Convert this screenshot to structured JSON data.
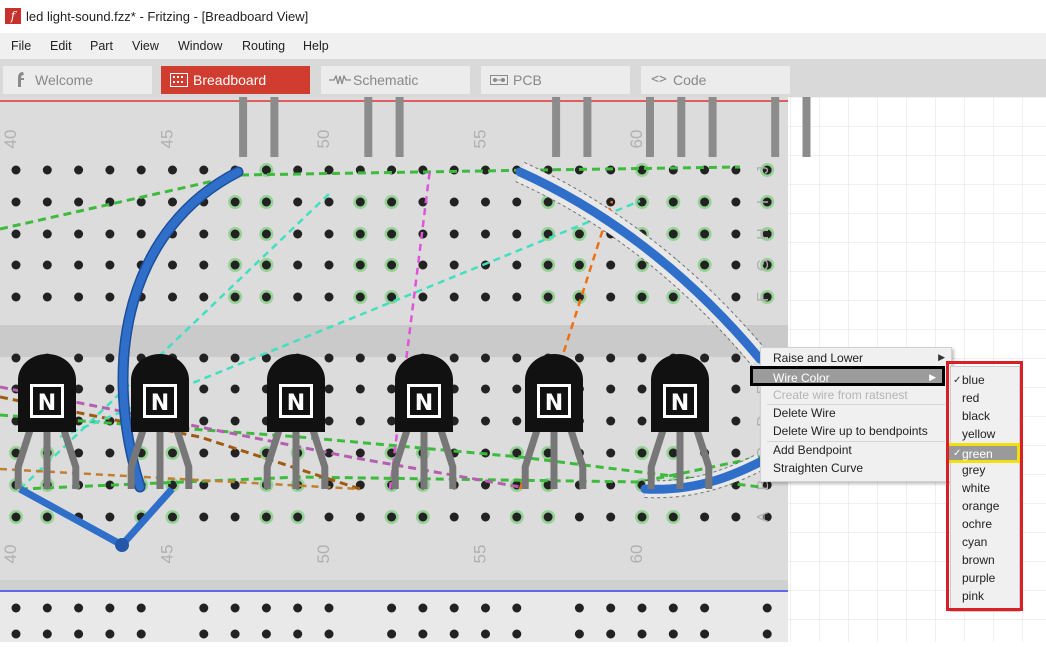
{
  "window": {
    "title": "led light-sound.fzz* - Fritzing - [Breadboard View]",
    "icon": "fritzing-f-icon"
  },
  "menubar": [
    "File",
    "Edit",
    "Part",
    "View",
    "Window",
    "Routing",
    "Help"
  ],
  "tabs": [
    {
      "label": "Welcome",
      "icon": "welcome-icon",
      "active": false
    },
    {
      "label": "Breadboard",
      "icon": "breadboard-icon",
      "active": true
    },
    {
      "label": "Schematic",
      "icon": "schematic-icon",
      "active": false
    },
    {
      "label": "PCB",
      "icon": "pcb-icon",
      "active": false
    },
    {
      "label": "Code",
      "icon": "code-icon",
      "active": false
    }
  ],
  "breadboard": {
    "column_labels": [
      "40",
      "45",
      "50",
      "55",
      "60"
    ],
    "row_labels_top": [
      "J",
      "I",
      "H",
      "G",
      "F"
    ],
    "row_labels_bottom": [
      "E",
      "D",
      "C",
      "B",
      "A"
    ],
    "transistor_label": "N",
    "colors": {
      "board": "#dcdcdc",
      "wire_blue": "#2f6fc9",
      "hole": "#222222",
      "hole_green": "#8ed08e",
      "rail_red": "#e23333",
      "rail_blue": "#3344ee"
    }
  },
  "context_menu": {
    "items": [
      {
        "label": "Raise and Lower",
        "submenu": true,
        "disabled": false
      },
      {
        "label": "Wire Color",
        "submenu": true,
        "disabled": false,
        "highlighted": true
      },
      {
        "label": "Create wire from ratsnest",
        "submenu": false,
        "disabled": true
      },
      {
        "label": "Delete Wire",
        "submenu": false,
        "disabled": false
      },
      {
        "label": "Delete Wire up to bendpoints",
        "submenu": false,
        "disabled": false
      },
      {
        "label": "Add Bendpoint",
        "submenu": false,
        "disabled": false
      },
      {
        "label": "Straighten Curve",
        "submenu": false,
        "disabled": false
      }
    ]
  },
  "wire_color_menu": {
    "options": [
      "blue",
      "red",
      "black",
      "yellow",
      "green",
      "grey",
      "white",
      "orange",
      "ochre",
      "cyan",
      "brown",
      "purple",
      "pink"
    ],
    "checked": "blue",
    "highlighted": "green",
    "highlight_check": "✓"
  }
}
